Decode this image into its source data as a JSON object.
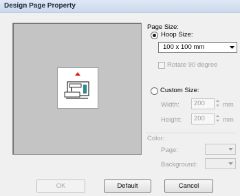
{
  "window": {
    "title": "Design Page Property"
  },
  "page_size": {
    "label": "Page Size:",
    "hoop_label": "Hoop Size:",
    "hoop_value": "100 x 100 mm",
    "rotate_label": "Rotate 90 degree",
    "custom_label": "Custom Size:",
    "width_label": "Width:",
    "width_value": "200",
    "height_label": "Height:",
    "height_value": "200",
    "unit": "mm"
  },
  "color": {
    "label": "Color:",
    "page_label": "Page:",
    "background_label": "Background:"
  },
  "buttons": {
    "ok": "OK",
    "default": "Default",
    "cancel": "Cancel"
  }
}
